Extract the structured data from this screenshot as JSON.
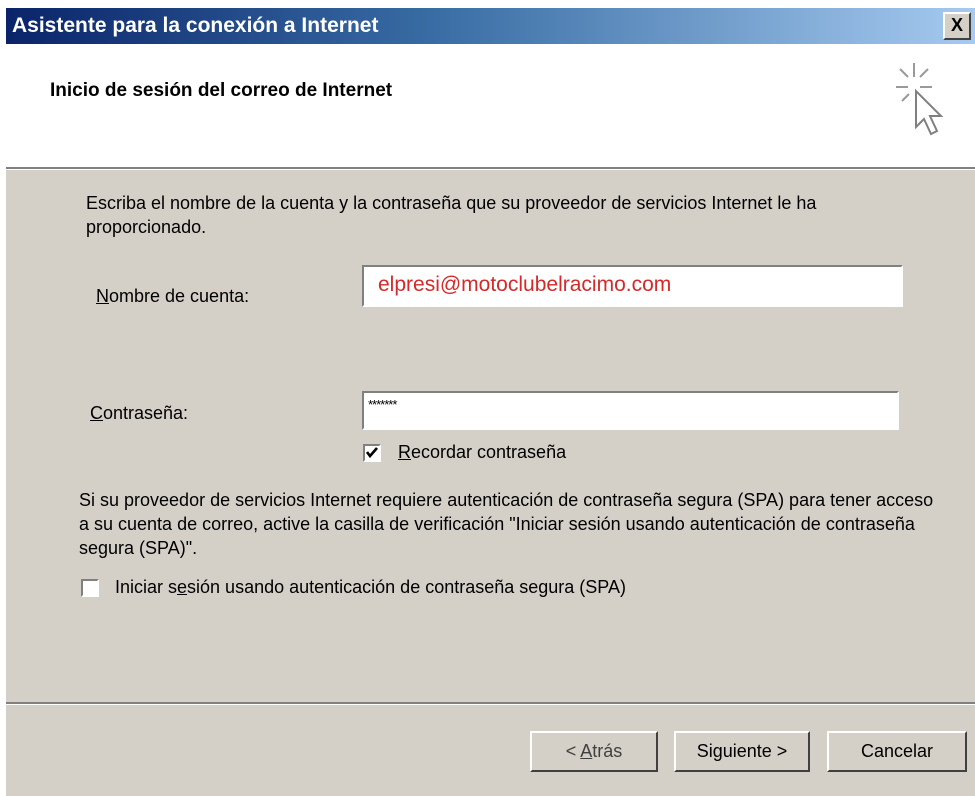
{
  "window": {
    "title": "Asistente para la conexión a Internet",
    "close_label": "X"
  },
  "header": {
    "title": "Inicio de sesión del correo de Internet",
    "icon": "wizard-sparkle-cursor-icon"
  },
  "body": {
    "instructions": "Escriba el nombre de la cuenta y la contraseña que su proveedor de servicios Internet le ha proporcionado.",
    "account_label_first": "N",
    "account_label_rest": "ombre de cuenta:",
    "account_value": "elpresi@motoclubelracimo.com",
    "password_label_first": "C",
    "password_label_rest": "ontraseña:",
    "password_value": "*******",
    "remember_checked": true,
    "remember_label_first": "R",
    "remember_label_rest": "ecordar contraseña",
    "spa_text": "Si su proveedor de servicios Internet requiere autenticación de contraseña segura (SPA) para tener acceso a su cuenta de correo, active la casilla de verificación \"Iniciar sesión usando autenticación de contraseña segura (SPA)\".",
    "spa_checked": false,
    "spa_label_a": "Iniciar s",
    "spa_label_u": "e",
    "spa_label_b": "sión usando autenticación de contraseña segura (SPA)"
  },
  "buttons": {
    "back_prefix": "< ",
    "back_accel": "A",
    "back_rest": "trás",
    "next": "Siguiente >",
    "cancel": "Cancelar"
  },
  "colors": {
    "title_gradient_start": "#0a246a",
    "title_gradient_end": "#a6caf0",
    "dialog_face": "#d4d0c8",
    "account_text": "#d42a2a"
  }
}
